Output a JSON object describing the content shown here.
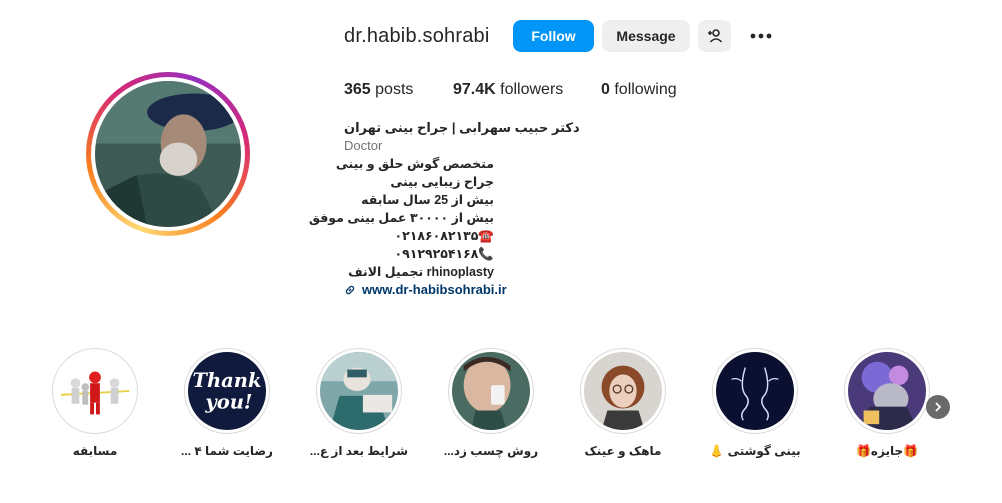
{
  "profile": {
    "username": "dr.habib.sohrabi",
    "follow_label": "Follow",
    "message_label": "Message",
    "stats": {
      "posts_count": "365",
      "posts_label": " posts",
      "followers_count": "97.4K",
      "followers_label": " followers",
      "following_count": "0",
      "following_label": " following"
    },
    "bio": {
      "name": "دکتر حبیب سهرابی | جراح بینی تهران",
      "category": "Doctor",
      "lines": [
        "متخصص گوش حلق و بینی",
        "جراح زیبایی بینی",
        "بیش از 25 سال سابقه",
        "بیش از ۳۰۰۰۰ عمل بینی موفق",
        "☎️۰۲۱۸۶۰۸۲۱۳۵",
        "📞۰۹۱۲۹۲۵۴۱۶۸",
        "rhinoplasty تجمیل الانف"
      ],
      "link": "www.dr-habibsohrabi.ir"
    }
  },
  "highlights": [
    {
      "label": "مسابقه",
      "icon": "race-winner"
    },
    {
      "label": "رضایت شما ۴ ...",
      "icon": "thank-you"
    },
    {
      "label": "شرایط بعد از ع...",
      "icon": "surgery"
    },
    {
      "label": "روش چسب زد...",
      "icon": "nose-tape"
    },
    {
      "label": "ماهک و عینک",
      "icon": "girl-glasses"
    },
    {
      "label": "بینی گوشتی 👃",
      "icon": "nose-drawing"
    },
    {
      "label": "🎁جایزه🎁",
      "icon": "gift-photo"
    }
  ],
  "colors": {
    "follow_button": "#0095f6",
    "secondary_button": "#efefef",
    "link": "#00376b",
    "muted_text": "#737373"
  }
}
